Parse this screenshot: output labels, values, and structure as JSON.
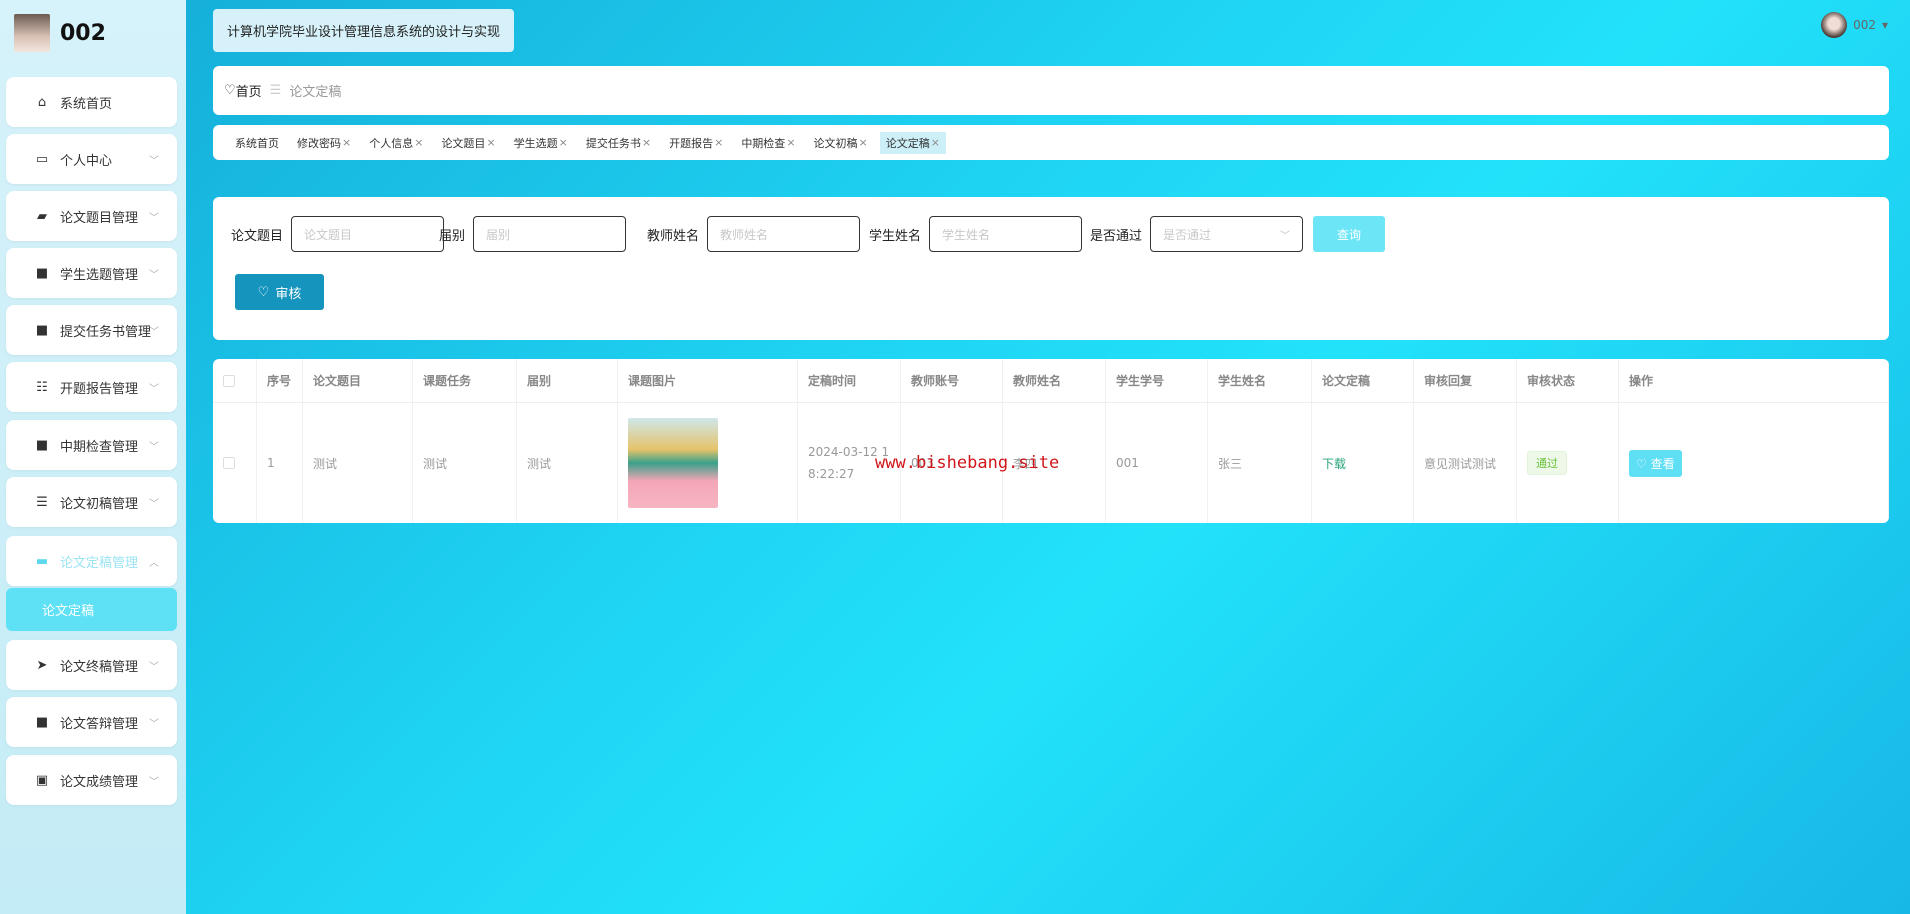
{
  "user": {
    "name": "002"
  },
  "app": {
    "title": "计算机学院毕业设计管理信息系统的设计与实现"
  },
  "sidebar": {
    "items": [
      {
        "label": "系统首页",
        "icon": "home-icon"
      },
      {
        "label": "个人中心",
        "icon": "card-icon"
      },
      {
        "label": "论文题目管理",
        "icon": "wallet-icon"
      },
      {
        "label": "学生选题管理",
        "icon": "grid-icon"
      },
      {
        "label": "提交任务书管理",
        "icon": "grid-icon"
      },
      {
        "label": "开题报告管理",
        "icon": "sliders-icon"
      },
      {
        "label": "中期检查管理",
        "icon": "grid-icon"
      },
      {
        "label": "论文初稿管理",
        "icon": "list-icon"
      },
      {
        "label": "论文定稿管理",
        "icon": "monitor-icon"
      },
      {
        "label": "论文终稿管理",
        "icon": "send-icon"
      },
      {
        "label": "论文答辩管理",
        "icon": "grid-icon"
      },
      {
        "label": "论文成绩管理",
        "icon": "clipboard-icon"
      }
    ],
    "submenu": {
      "label": "论文定稿"
    }
  },
  "breadcrumb": {
    "home": "首页",
    "current": "论文定稿"
  },
  "tabs": [
    "系统首页",
    "修改密码",
    "个人信息",
    "论文题目",
    "学生选题",
    "提交任务书",
    "开题报告",
    "中期检查",
    "论文初稿",
    "论文定稿"
  ],
  "search": {
    "fields": [
      {
        "label": "论文题目",
        "placeholder": "论文题目"
      },
      {
        "label": "届别",
        "placeholder": "届别"
      },
      {
        "label": "教师姓名",
        "placeholder": "教师姓名"
      },
      {
        "label": "学生姓名",
        "placeholder": "学生姓名"
      },
      {
        "label": "是否通过",
        "placeholder": "是否通过"
      }
    ],
    "query": "查询",
    "audit": "审核"
  },
  "table": {
    "headers": [
      "序号",
      "论文题目",
      "课题任务",
      "届别",
      "课题图片",
      "定稿时间",
      "教师账号",
      "教师姓名",
      "学生学号",
      "学生姓名",
      "论文定稿",
      "审核回复",
      "审核状态",
      "操作"
    ],
    "rows": [
      {
        "no": "1",
        "title": "测试",
        "task": "测试",
        "session": "测试",
        "time": "2024-03-12 18:22:27",
        "teacher_id": "003",
        "teacher_name": "李四",
        "student_id": "001",
        "student_name": "张三",
        "file": "下载",
        "reply": "意见测试测试",
        "status": "通过",
        "action": "查看"
      }
    ]
  },
  "watermark": "www.bishebang.site",
  "colors": {
    "accent": "#5fdff3",
    "primary": "#1594bd",
    "success": "#67c23a"
  }
}
